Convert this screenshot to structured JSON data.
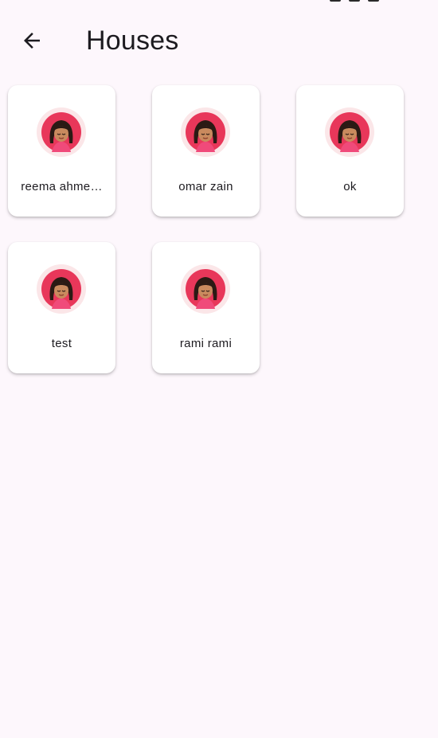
{
  "app_bar": {
    "title": "Houses",
    "back_icon": "arrow-back-icon"
  },
  "houses": [
    {
      "label": "reema ahme…",
      "avatar_icon": "girl-avatar-icon"
    },
    {
      "label": "omar zain",
      "avatar_icon": "girl-avatar-icon"
    },
    {
      "label": "ok",
      "avatar_icon": "girl-avatar-icon"
    },
    {
      "label": "test",
      "avatar_icon": "girl-avatar-icon"
    },
    {
      "label": "rami rami",
      "avatar_icon": "girl-avatar-icon"
    }
  ],
  "colors": {
    "background": "#fdf7fc",
    "card": "#ffffff",
    "avatar_ring": "#fbe6e8",
    "avatar_circle": "#e8375a",
    "text": "#1d1b20"
  }
}
